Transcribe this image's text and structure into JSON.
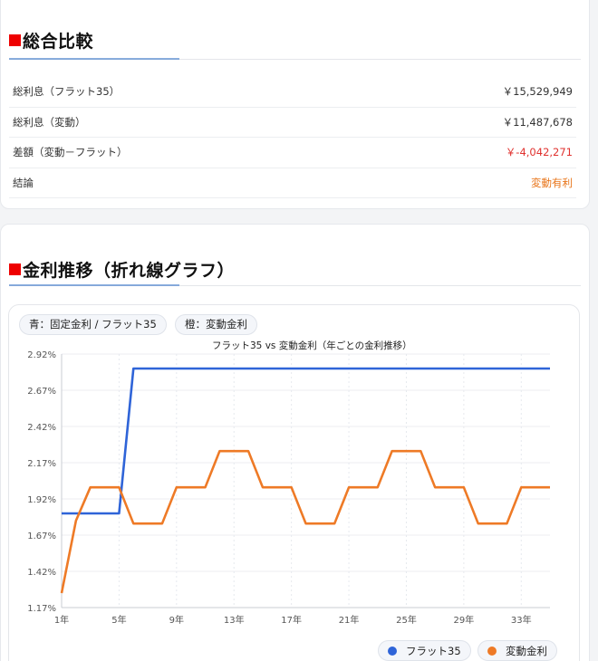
{
  "summary": {
    "title": "総合比較",
    "rows": [
      {
        "label": "総利息（フラット35）",
        "value": "￥15,529,949"
      },
      {
        "label": "総利息（変動）",
        "value": "￥11,487,678"
      },
      {
        "label": "差額（変動－フラット）",
        "value": "￥-4,042,271"
      },
      {
        "label": "結論",
        "value": "変動有利"
      }
    ]
  },
  "rate_section": {
    "title": "金利推移（折れ線グラフ）",
    "pills": [
      "青：固定金利 / フラット35",
      "橙：変動金利"
    ],
    "legend": [
      "フラット35",
      "変動金利"
    ]
  },
  "colors": {
    "accent_red": "#ee0000",
    "flat": "#2f64d8",
    "variable": "#ee7a26",
    "negative": "#e0322f"
  },
  "chart_data": {
    "type": "line",
    "title": "フラット35 vs 変動金利（年ごとの金利推移）",
    "x": [
      1,
      2,
      3,
      4,
      5,
      6,
      7,
      8,
      9,
      10,
      11,
      12,
      13,
      14,
      15,
      16,
      17,
      18,
      19,
      20,
      21,
      22,
      23,
      24,
      25,
      26,
      27,
      28,
      29,
      30,
      31,
      32,
      33,
      34,
      35
    ],
    "x_tick_labels": [
      "1年",
      "5年",
      "9年",
      "13年",
      "17年",
      "21年",
      "25年",
      "29年",
      "33年"
    ],
    "y_tick_labels": [
      "2.92%",
      "2.67%",
      "2.42%",
      "2.17%",
      "1.92%",
      "1.67%",
      "1.42%",
      "1.17%"
    ],
    "ylim": [
      1.17,
      2.92
    ],
    "series": [
      {
        "name": "フラット35",
        "color": "#2f64d8",
        "step": true,
        "values": [
          1.82,
          1.82,
          1.82,
          1.82,
          1.82,
          2.82,
          2.82,
          2.82,
          2.82,
          2.82,
          2.82,
          2.82,
          2.82,
          2.82,
          2.82,
          2.82,
          2.82,
          2.82,
          2.82,
          2.82,
          2.82,
          2.82,
          2.82,
          2.82,
          2.82,
          2.82,
          2.82,
          2.82,
          2.82,
          2.82,
          2.82,
          2.82,
          2.82,
          2.82,
          2.82
        ]
      },
      {
        "name": "変動金利",
        "color": "#ee7a26",
        "values": [
          1.27,
          1.77,
          2.0,
          2.0,
          2.0,
          1.75,
          1.75,
          1.75,
          2.0,
          2.0,
          2.0,
          2.25,
          2.25,
          2.25,
          2.0,
          2.0,
          2.0,
          1.75,
          1.75,
          1.75,
          2.0,
          2.0,
          2.0,
          2.25,
          2.25,
          2.25,
          2.0,
          2.0,
          2.0,
          1.75,
          1.75,
          1.75,
          2.0,
          2.0,
          2.0
        ]
      }
    ],
    "grid": true,
    "legend_position": "bottom-right"
  }
}
